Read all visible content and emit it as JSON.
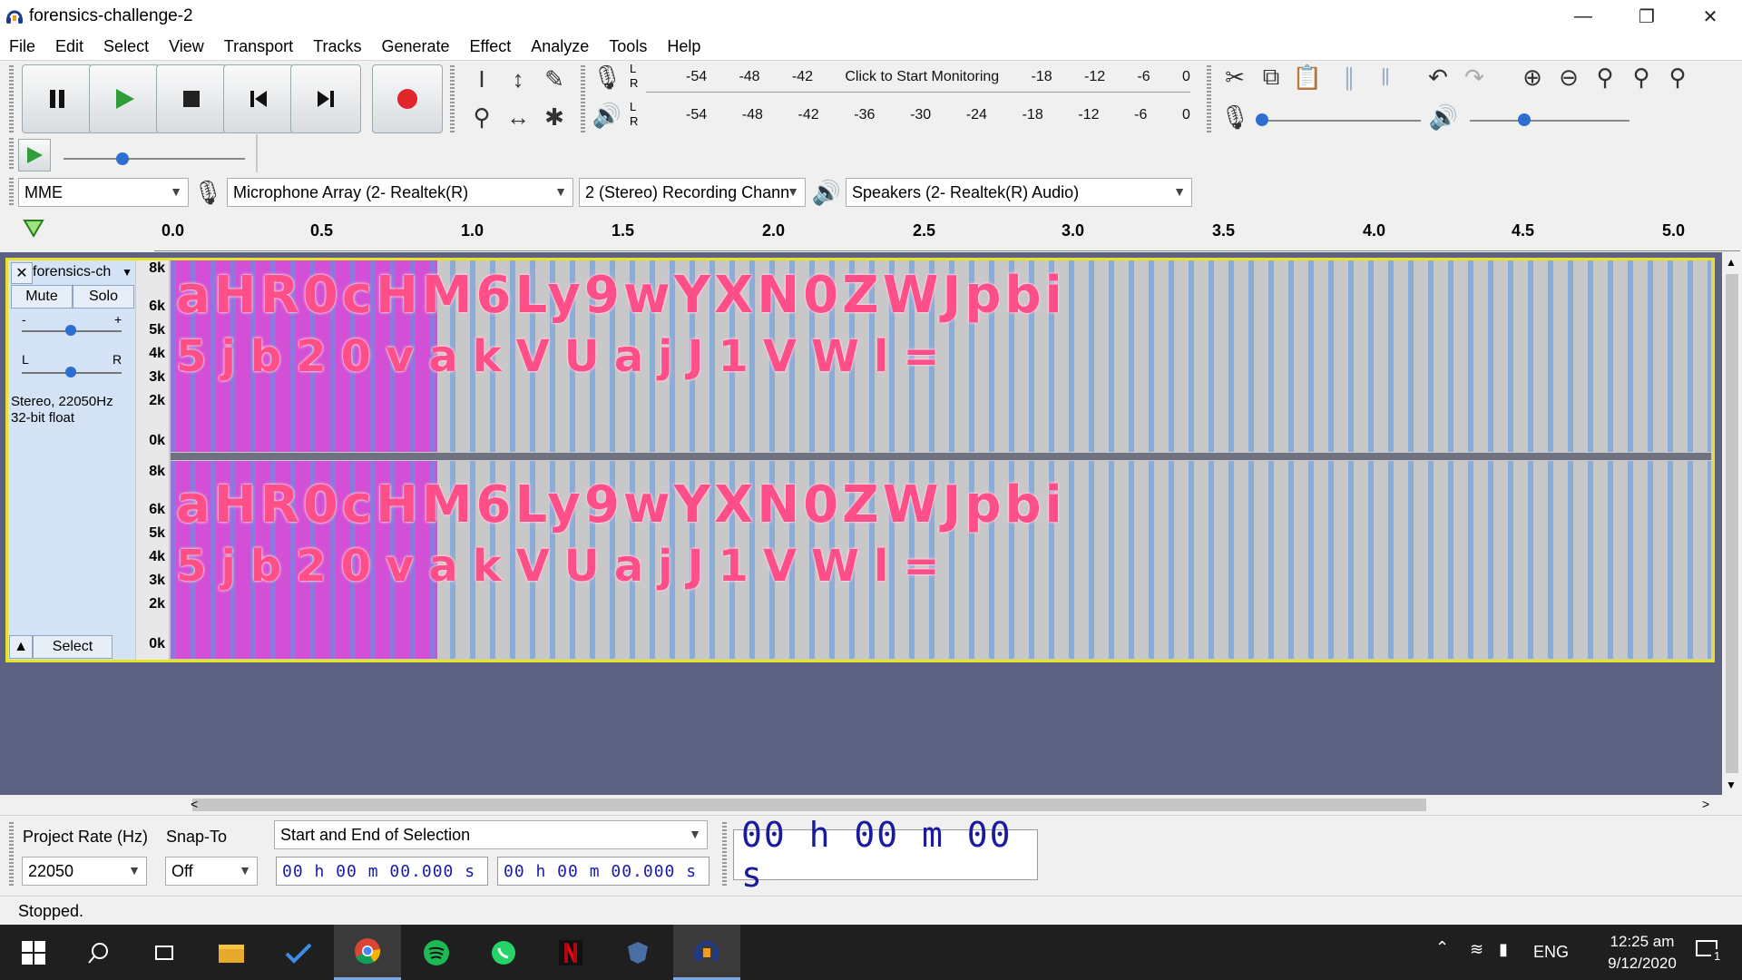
{
  "window": {
    "title": "forensics-challenge-2"
  },
  "menu": [
    "File",
    "Edit",
    "Select",
    "View",
    "Transport",
    "Tracks",
    "Generate",
    "Effect",
    "Analyze",
    "Tools",
    "Help"
  ],
  "meters": {
    "record_scale": [
      "-54",
      "-48",
      "-42",
      "Click to Start Monitoring",
      "-18",
      "-12",
      "-6",
      "0"
    ],
    "play_scale": [
      "-54",
      "-48",
      "-42",
      "-36",
      "-30",
      "-24",
      "-18",
      "-12",
      "-6",
      "0"
    ],
    "lr": [
      "L",
      "R"
    ]
  },
  "devices": {
    "host": "MME",
    "mic": "Microphone Array (2- Realtek(R)",
    "channels": "2 (Stereo) Recording Chann",
    "speakers": "Speakers (2- Realtek(R) Audio)"
  },
  "ruler": [
    "0.0",
    "0.5",
    "1.0",
    "1.5",
    "2.0",
    "2.5",
    "3.0",
    "3.5",
    "4.0",
    "4.5",
    "5.0"
  ],
  "track": {
    "name": "forensics-ch",
    "mute": "Mute",
    "solo": "Solo",
    "gain_minus": "-",
    "gain_plus": "+",
    "pan_left": "L",
    "pan_right": "R",
    "info_line1": "Stereo, 22050Hz",
    "info_line2": "32-bit float",
    "select": "Select",
    "freq_labels": [
      "8k",
      "6k",
      "5k",
      "4k",
      "3k",
      "2k",
      "0k"
    ],
    "spectrogram_line1": "aHR0cHM6Ly9wYXN0ZWJpbi",
    "spectrogram_line2": "5jb20vakVUajJ1VWl="
  },
  "selection": {
    "rate_label": "Project Rate (Hz)",
    "rate_value": "22050",
    "snap_label": "Snap-To",
    "snap_value": "Off",
    "mode": "Start and End of Selection",
    "start": "00 h 00 m 00.000 s",
    "end": "00 h 00 m 00.000 s",
    "audio_position": "00 h 00 m 00 s"
  },
  "status": "Stopped.",
  "taskbar": {
    "lang": "ENG",
    "time": "12:25 am",
    "date": "9/12/2020",
    "notif_count": "1"
  },
  "colors": {
    "accent_yellow": "#e8e12a",
    "spectro_text": "#ff4f88",
    "magenta": "#d24fd6",
    "record_red": "#e0262b",
    "play_green": "#2f9e3a"
  }
}
